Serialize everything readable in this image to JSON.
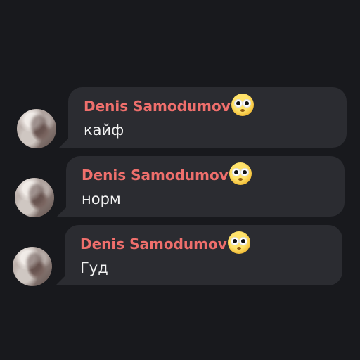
{
  "messages": [
    {
      "sender": "Denis Samodumov",
      "text": "кайф",
      "avatar": "user-avatar",
      "emoji": "flushed-face-emoji"
    },
    {
      "sender": "Denis Samodumov",
      "text": "норм",
      "avatar": "user-avatar",
      "emoji": "flushed-face-emoji"
    },
    {
      "sender": "Denis Samodumov",
      "text": "Гуд",
      "avatar": "user-avatar",
      "emoji": "flushed-face-emoji"
    }
  ],
  "colors": {
    "background": "#18191d",
    "bubble": "#2b2c31",
    "sender": "#ef6f6c",
    "text": "#f2f2f2"
  }
}
